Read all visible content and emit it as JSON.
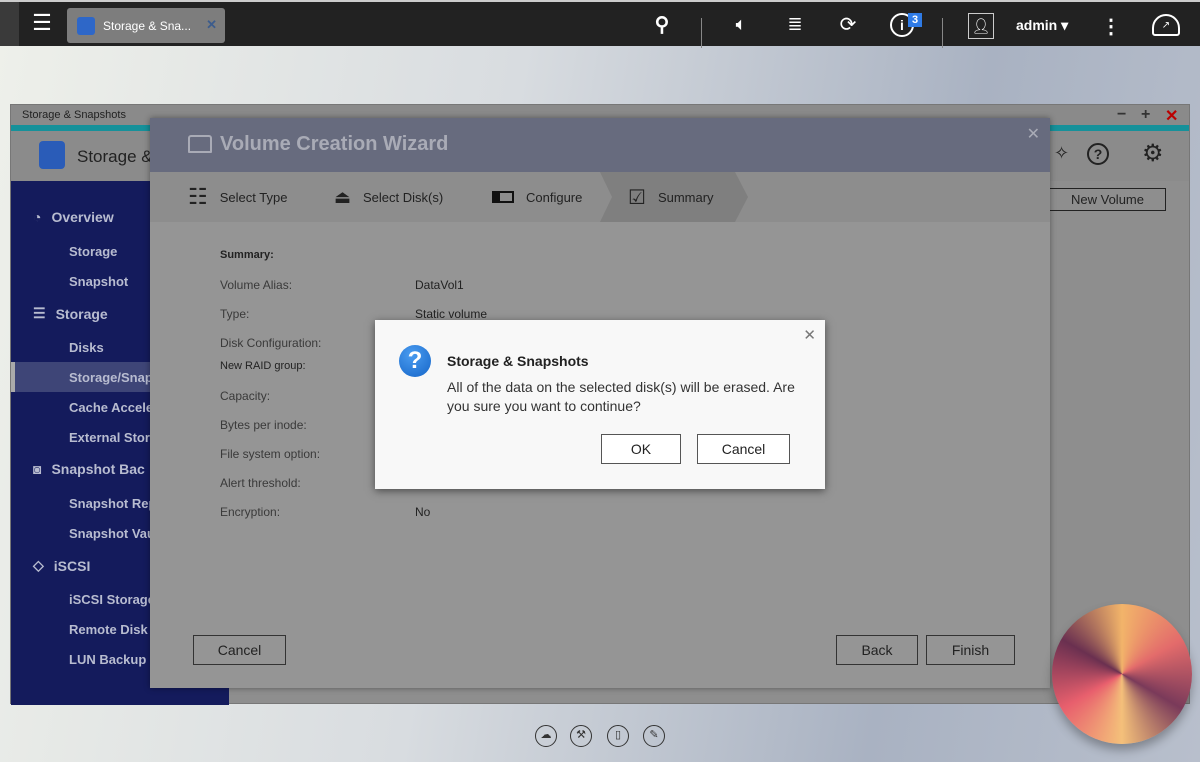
{
  "topbar": {
    "tab_label": "Storage & Sna...",
    "notification_count": "3",
    "user": "admin"
  },
  "window": {
    "title": "Storage & Snapshots",
    "header_title": "Storage &",
    "new_volume": "New Volume"
  },
  "sidebar": {
    "groups": [
      {
        "label": "Overview",
        "items": [
          "Storage",
          "Snapshot"
        ]
      },
      {
        "label": "Storage",
        "items": [
          "Disks",
          "Storage/Snap",
          "Cache Acceler",
          "External Stora"
        ]
      },
      {
        "label": "Snapshot Bac",
        "items": [
          "Snapshot Rep",
          "Snapshot Vau"
        ]
      },
      {
        "label": "iSCSI",
        "items": [
          "iSCSI Storage",
          "Remote Disk",
          "LUN Backup"
        ]
      }
    ],
    "selected": "Storage/Snap"
  },
  "wizard": {
    "title": "Volume Creation Wizard",
    "steps": [
      "Select Type",
      "Select Disk(s)",
      "Configure",
      "Summary"
    ],
    "active_step": "Summary",
    "summary_heading": "Summary:",
    "rows": [
      {
        "label": "Volume Alias:",
        "value": "DataVol1"
      },
      {
        "label": "Type:",
        "value": "Static volume"
      },
      {
        "label": "Disk Configuration:",
        "value": ""
      },
      {
        "label": "New RAID group:",
        "value": ""
      },
      {
        "label": "Capacity:",
        "value": ""
      },
      {
        "label": "Bytes per inode:",
        "value": ""
      },
      {
        "label": "File system option:",
        "value": ""
      },
      {
        "label": "Alert threshold:",
        "value": ""
      },
      {
        "label": "Encryption:",
        "value": "No"
      }
    ],
    "cancel": "Cancel",
    "back": "Back",
    "finish": "Finish"
  },
  "dialog": {
    "title": "Storage & Snapshots",
    "message": "All of the data on the selected disk(s) will be erased. Are you sure you want to continue?",
    "ok": "OK",
    "cancel": "Cancel"
  },
  "colors": {
    "sidebar": "#141b5c",
    "wizard_header": "#676b7e",
    "dialog_icon": "#1e76dc",
    "badge": "#2f7be6"
  }
}
